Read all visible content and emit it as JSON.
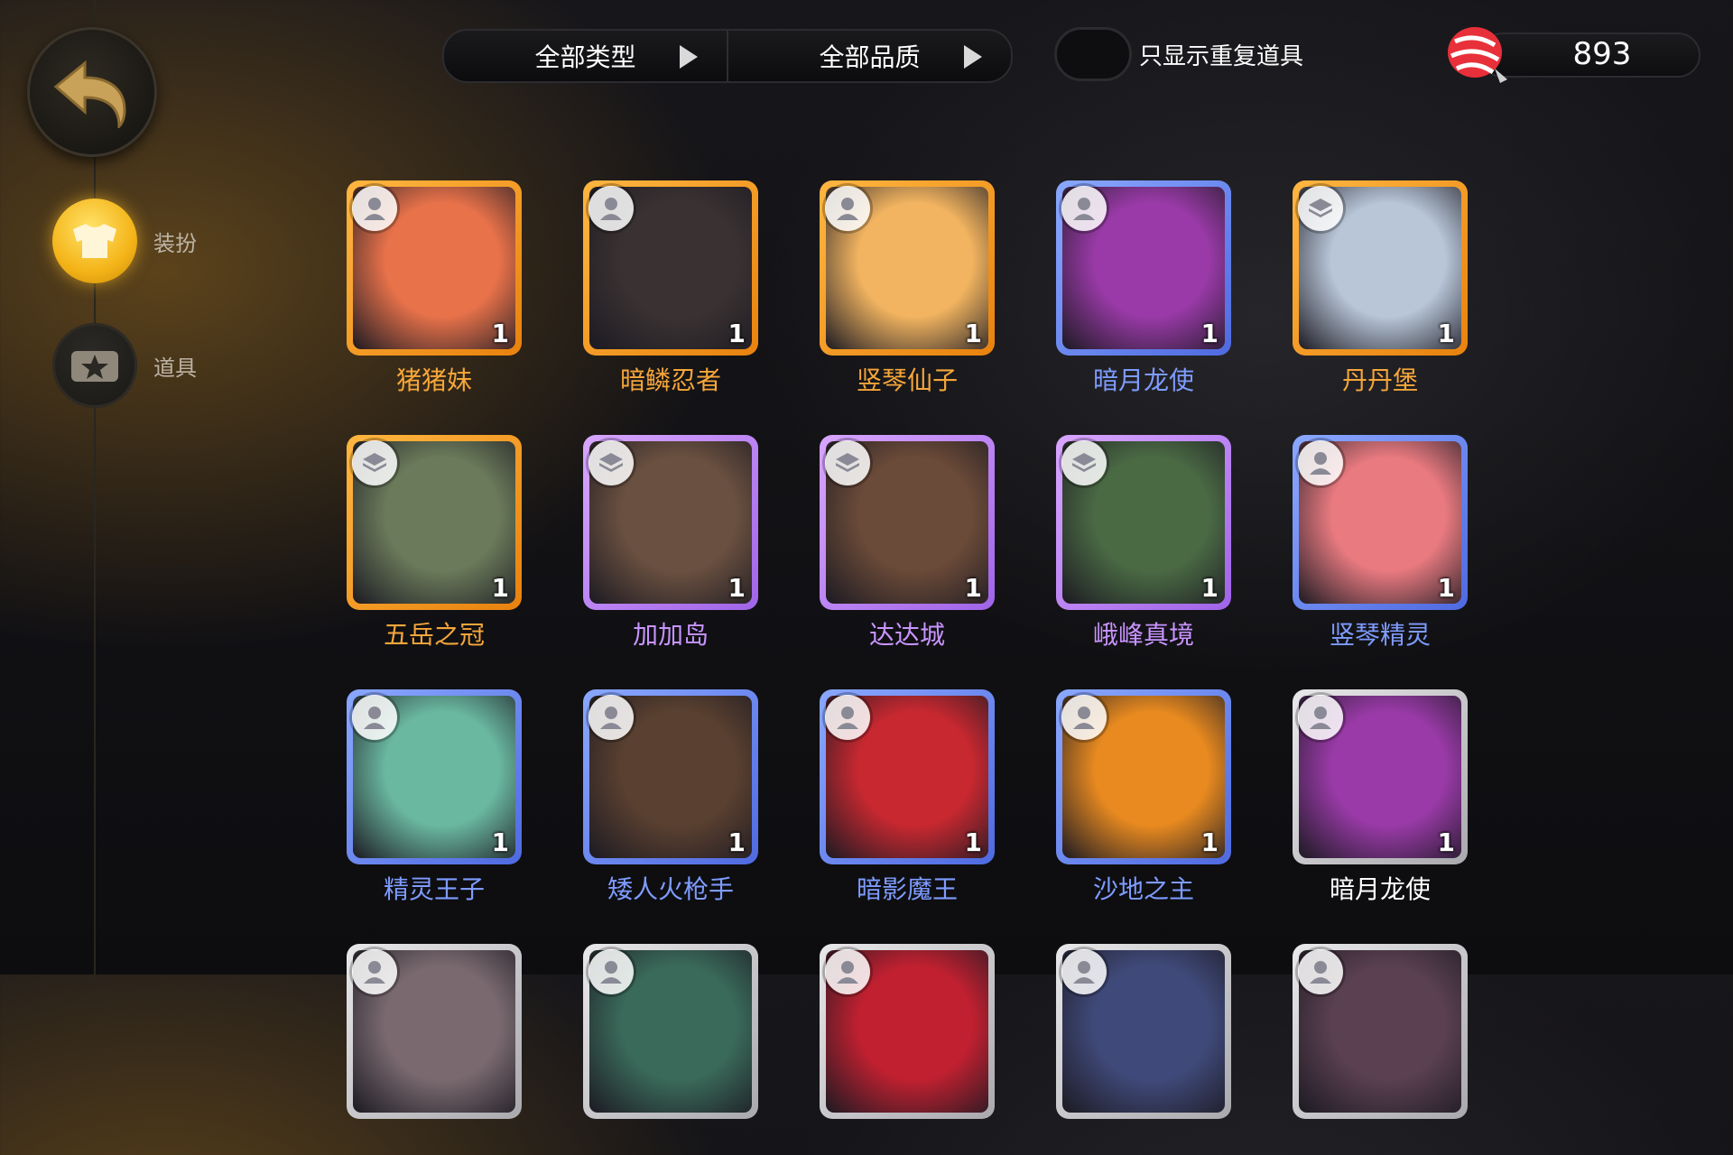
{
  "filters": {
    "type_label": "全部类型",
    "quality_label": "全部品质"
  },
  "toggle": {
    "label": "只显示重复道具",
    "on": false
  },
  "currency": {
    "value": "893"
  },
  "sidebar": {
    "items": [
      {
        "label": "装扮",
        "icon": "costume-icon",
        "active": true
      },
      {
        "label": "道具",
        "icon": "item-icon",
        "active": false
      }
    ]
  },
  "cards": [
    {
      "name": "猪猪妹",
      "count": "1",
      "quality": "orange",
      "category": "avatar",
      "color": "#e8724a"
    },
    {
      "name": "暗鳞忍者",
      "count": "1",
      "quality": "orange",
      "category": "avatar",
      "color": "#3a3232"
    },
    {
      "name": "竖琴仙子",
      "count": "1",
      "quality": "orange",
      "category": "avatar",
      "color": "#f2b460"
    },
    {
      "name": "暗月龙使",
      "count": "1",
      "quality": "blue",
      "category": "avatar",
      "color": "#9a3aa8"
    },
    {
      "name": "丹丹堡",
      "count": "1",
      "quality": "orange",
      "category": "board",
      "color": "#b8c6d8"
    },
    {
      "name": "五岳之冠",
      "count": "1",
      "quality": "orange",
      "category": "board",
      "color": "#6a7a5a"
    },
    {
      "name": "加加岛",
      "count": "1",
      "quality": "purple",
      "category": "board",
      "color": "#6a5040"
    },
    {
      "name": "达达城",
      "count": "1",
      "quality": "purple",
      "category": "board",
      "color": "#6a4a38"
    },
    {
      "name": "峨峰真境",
      "count": "1",
      "quality": "purple",
      "category": "board",
      "color": "#4a6a44"
    },
    {
      "name": "竖琴精灵",
      "count": "1",
      "quality": "blue",
      "category": "avatar",
      "color": "#e87a80"
    },
    {
      "name": "精灵王子",
      "count": "1",
      "quality": "blue",
      "category": "avatar",
      "color": "#6ab8a0"
    },
    {
      "name": "矮人火枪手",
      "count": "1",
      "quality": "blue",
      "category": "avatar",
      "color": "#5a4030"
    },
    {
      "name": "暗影魔王",
      "count": "1",
      "quality": "blue",
      "category": "avatar",
      "color": "#c82830"
    },
    {
      "name": "沙地之主",
      "count": "1",
      "quality": "blue",
      "category": "avatar",
      "color": "#e88a20"
    },
    {
      "name": "暗月龙使",
      "count": "1",
      "quality": "white",
      "category": "avatar",
      "color": "#9a3aa8"
    },
    {
      "name": "",
      "count": "",
      "quality": "white",
      "category": "avatar",
      "color": "#7a6a70"
    },
    {
      "name": "",
      "count": "",
      "quality": "white",
      "category": "avatar",
      "color": "#3a6a5a"
    },
    {
      "name": "",
      "count": "",
      "quality": "white",
      "category": "avatar",
      "color": "#c02030"
    },
    {
      "name": "",
      "count": "",
      "quality": "white",
      "category": "avatar",
      "color": "#404a7a"
    },
    {
      "name": "",
      "count": "",
      "quality": "white",
      "category": "avatar",
      "color": "#5a4050"
    }
  ]
}
